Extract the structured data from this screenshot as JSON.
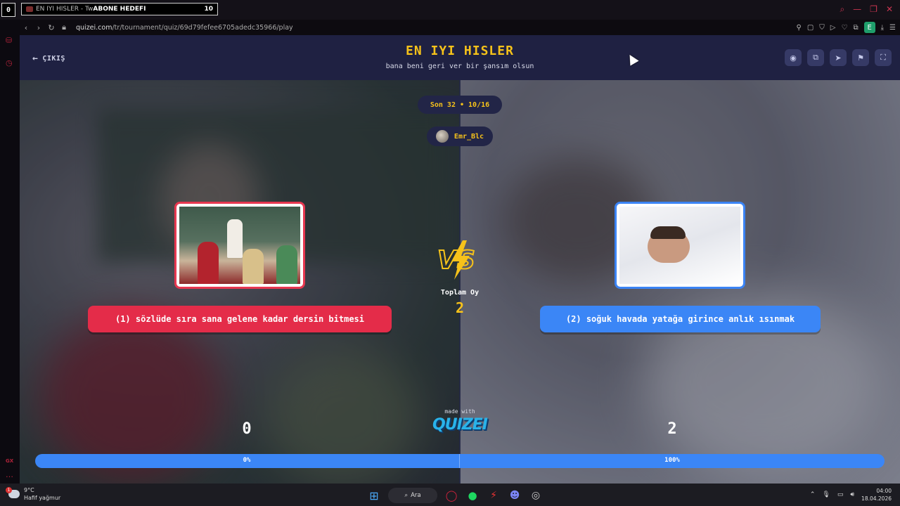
{
  "browser": {
    "tab_count": "0",
    "tab_title_prefix": "EN IYI HISLER - Tw",
    "tab_title_overlay": "ABONE HEDEFI",
    "tab_counter": "10",
    "url_host": "quizei.com",
    "url_path": "/tr/tournament/quiz/69d79fefee6705adedc35966/play",
    "extension_label": "E",
    "sidebar_label": "GX"
  },
  "header": {
    "exit_label": "ÇIKIŞ",
    "title": "EN IYI HISLER",
    "subtitle": "bana beni geri ver bir şansım olsun"
  },
  "round": {
    "label": "Son 32 • 10/16",
    "user": "Emr_Blc"
  },
  "choices": {
    "left": {
      "label": "(1) sözlüde sıra sana gelene kadar dersin bitmesi",
      "score": "0",
      "percent_label": "0%",
      "percent": 0,
      "color": "#e42c49"
    },
    "right": {
      "label": "(2) soğuk havada yatağa girince anlık ısınmak",
      "score": "2",
      "percent_label": "100%",
      "percent": 100,
      "color": "#3b86f6"
    }
  },
  "totals": {
    "label": "Toplam Oy",
    "value": "2"
  },
  "branding": {
    "made_with": "made with",
    "logo": "QUIZEI"
  },
  "taskbar": {
    "temp": "9°C",
    "weather": "Hafif yağmur",
    "weather_badge": "1",
    "search": "Ara",
    "time": "04:00",
    "date": "18.04.2026"
  },
  "colors": {
    "accent_yellow": "#f6c21a",
    "red": "#e42c49",
    "blue": "#3b86f6",
    "header_bg": "#1f2142"
  }
}
